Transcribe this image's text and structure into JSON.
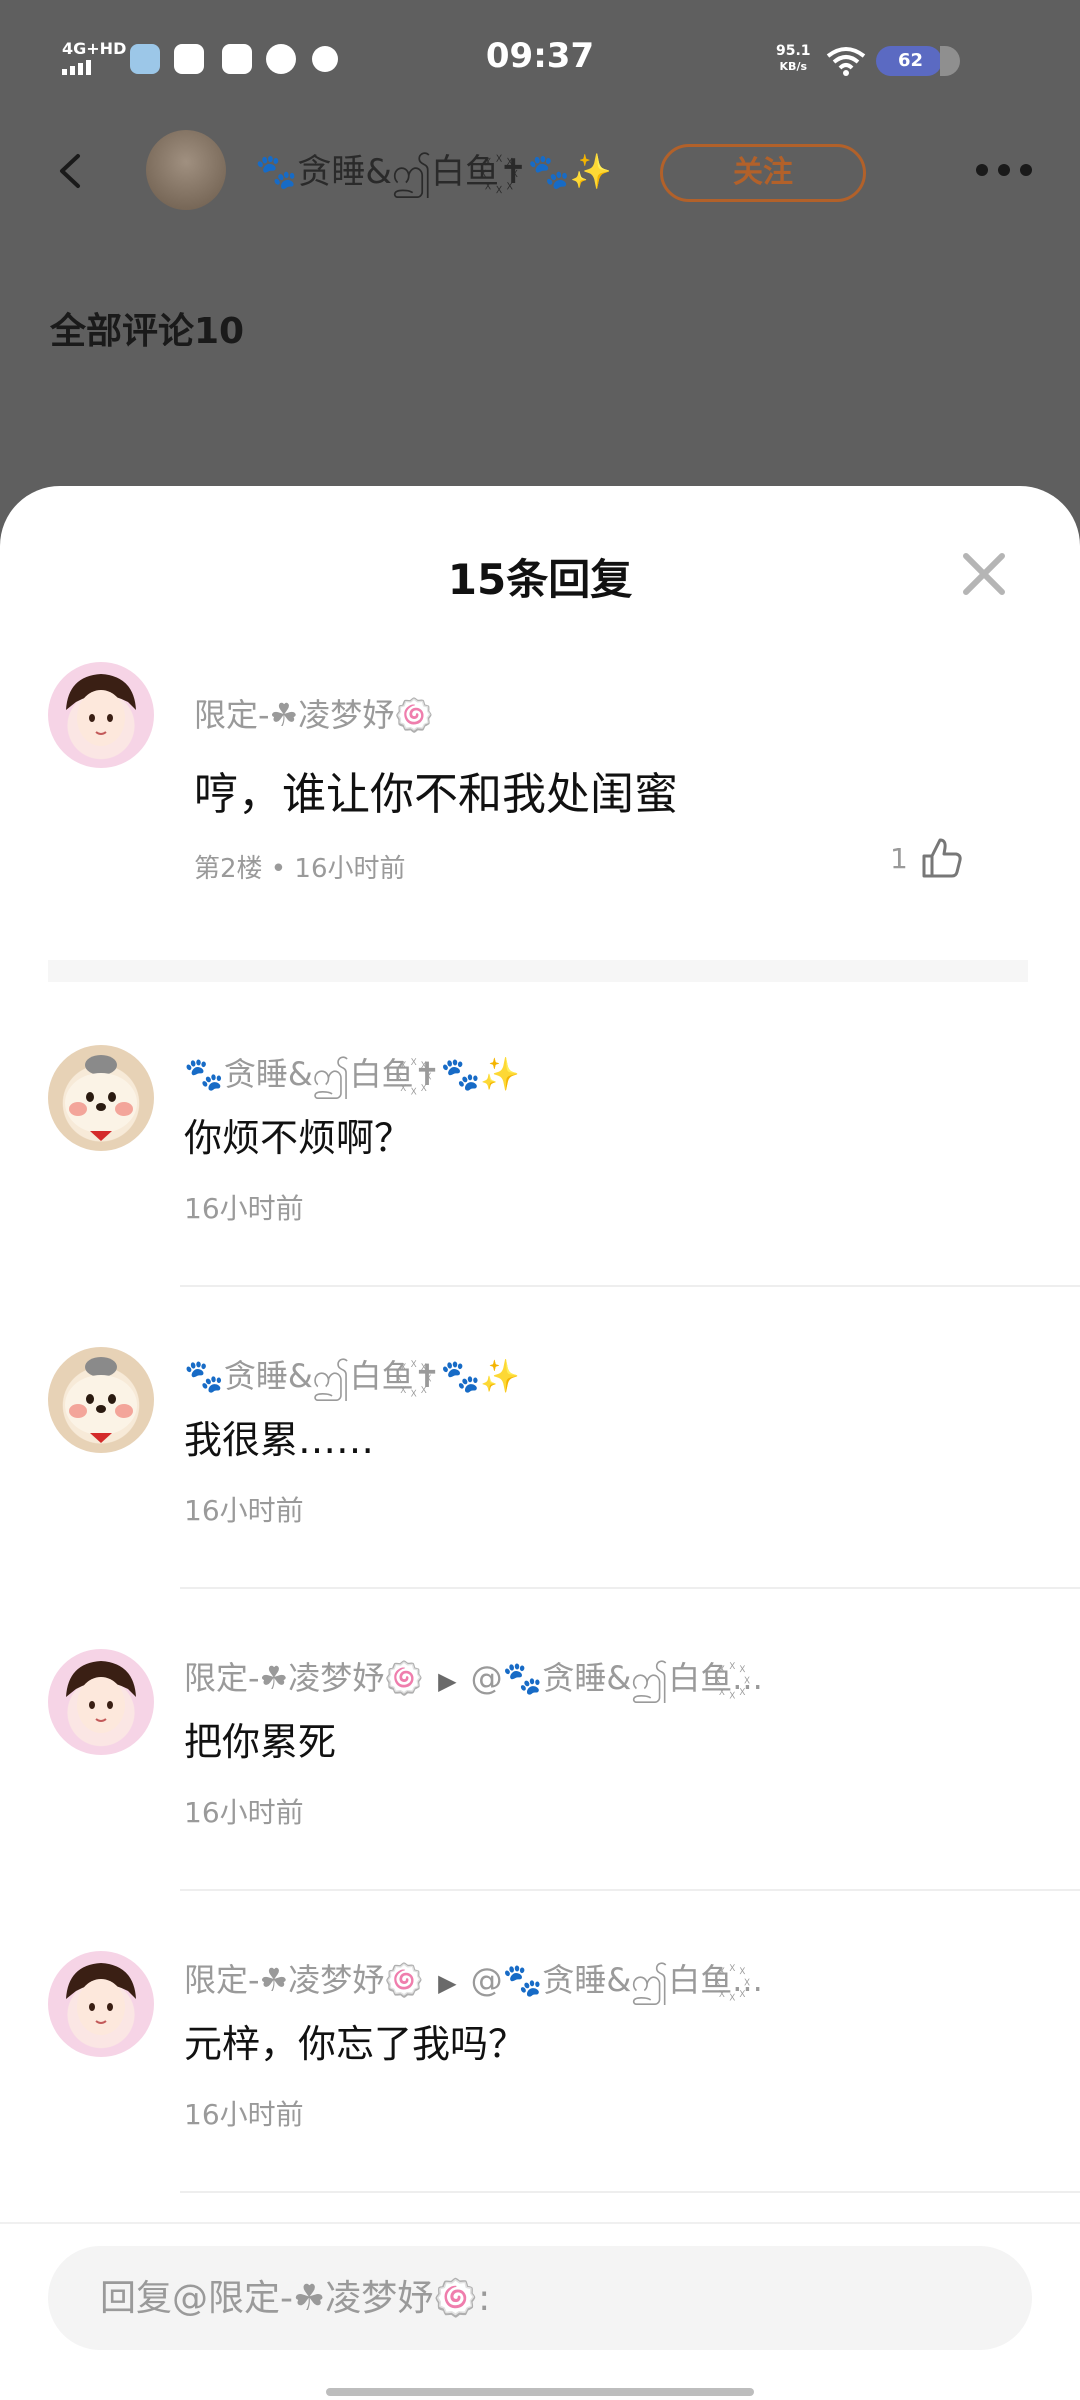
{
  "status": {
    "network": "4G+HD",
    "time": "09:37",
    "speed_value": "95.1",
    "speed_unit": "KB/s",
    "battery": "62"
  },
  "background_page": {
    "author_name": "🐾贪睡&ဤ白鱼꙰✝🐾✨",
    "follow_label": "关注",
    "all_comments_label": "全部评论10"
  },
  "sheet": {
    "title": "15条回复",
    "main_comment": {
      "name": "限定-☘凌梦妤🍥",
      "text": "哼，谁让你不和我处闺蜜",
      "meta": "第2楼 • 16小时前",
      "likes": "1"
    },
    "replies": [
      {
        "name": "🐾贪睡&ဤ白鱼꙰✝🐾✨",
        "target": "",
        "text": "你烦不烦啊？",
        "time": "16小时前",
        "avatar": "dog"
      },
      {
        "name": "🐾贪睡&ဤ白鱼꙰✝🐾✨",
        "target": "",
        "text": "我很累……",
        "time": "16小时前",
        "avatar": "dog"
      },
      {
        "name": "限定-☘凌梦妤🍥",
        "target": "@🐾贪睡&ဤ白鱼꙰...",
        "text": "把你累死",
        "time": "16小时前",
        "avatar": "girl"
      },
      {
        "name": "限定-☘凌梦妤🍥",
        "target": "@🐾贪睡&ဤ白鱼꙰...",
        "text": "元梓，你忘了我吗？",
        "time": "16小时前",
        "avatar": "girl"
      }
    ],
    "input_placeholder": "回复@限定-☘凌梦妤🍥:"
  },
  "colors": {
    "overlay": "#5f5f5f",
    "follow": "#b2612a",
    "battery": "#5b6ac2"
  }
}
